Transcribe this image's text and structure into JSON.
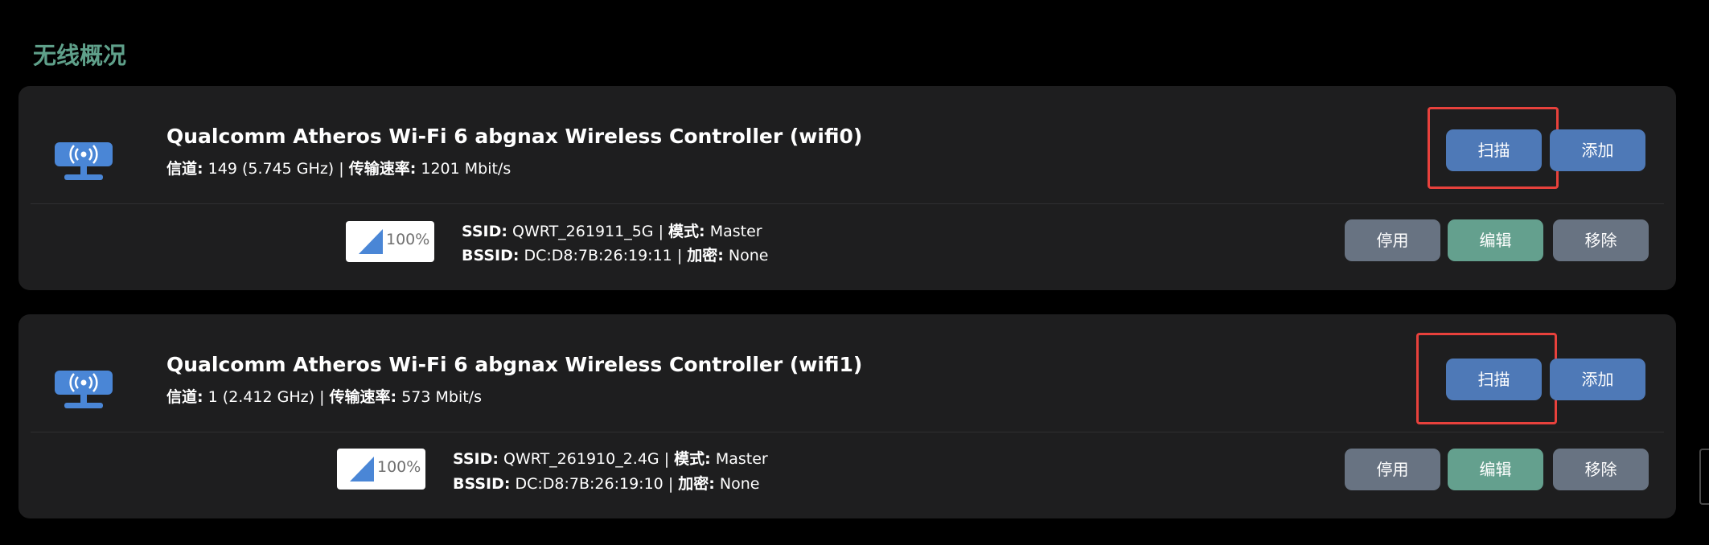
{
  "section_title": "无线概况",
  "labels": {
    "channel": "信道:",
    "rate": "传输速率:",
    "ssid": "SSID:",
    "mode": "模式:",
    "bssid": "BSSID:",
    "encryption": "加密:",
    "sep": "|"
  },
  "buttons": {
    "scan": "扫描",
    "add": "添加",
    "disable": "停用",
    "edit": "编辑",
    "remove": "移除"
  },
  "colors": {
    "title_accent": "#5fa08a",
    "card_bg": "#1e1e1f",
    "button_blue": "#4e79b7",
    "button_gray": "#687382",
    "button_green": "#64a08e",
    "highlight_red": "#e8413c",
    "icon_blue": "#4a86d6"
  },
  "devices": [
    {
      "name": "Qualcomm Atheros Wi-Fi 6 abgnax Wireless Controller (wifi0)",
      "channel": "149 (5.745 GHz)",
      "rate": "1201 Mbit/s",
      "network": {
        "signal": "100%",
        "ssid": "QWRT_261911_5G",
        "mode": "Master",
        "bssid": "DC:D8:7B:26:19:11",
        "encryption": "None"
      }
    },
    {
      "name": "Qualcomm Atheros Wi-Fi 6 abgnax Wireless Controller (wifi1)",
      "channel": "1 (2.412 GHz)",
      "rate": "573 Mbit/s",
      "network": {
        "signal": "100%",
        "ssid": "QWRT_261910_2.4G",
        "mode": "Master",
        "bssid": "DC:D8:7B:26:19:10",
        "encryption": "None"
      }
    }
  ]
}
